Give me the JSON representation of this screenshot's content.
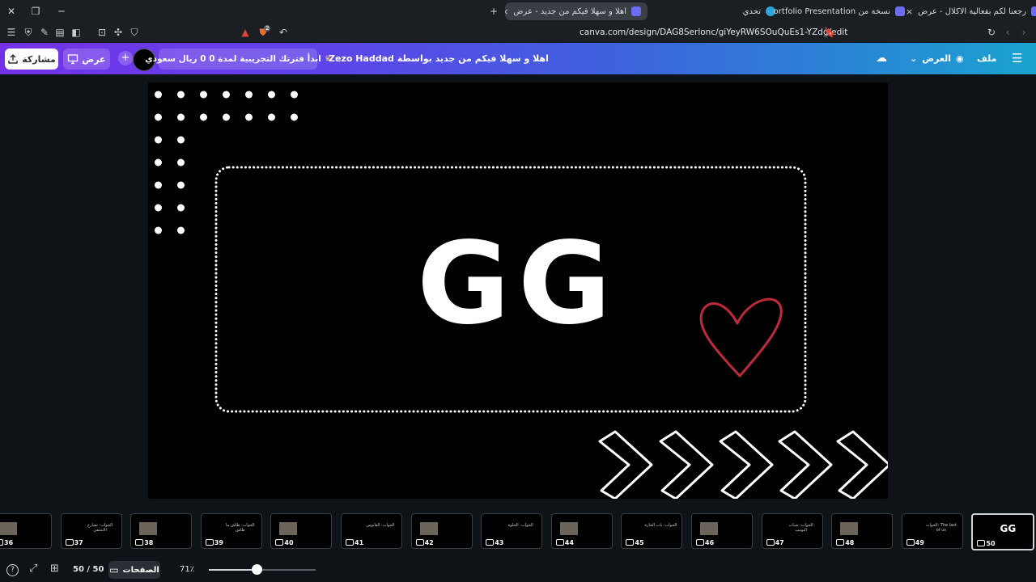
{
  "browser": {
    "tabs": [
      {
        "title": "رجعنا لكم بفعالية الاكلال - عرض",
        "favicon_color": "#6b6cf0",
        "active": false
      },
      {
        "title": "نسخة من Geometric Portfolio Presentation",
        "favicon_color": "#6b6cf0",
        "active": false
      },
      {
        "title": "تحدي",
        "favicon_color": "#2aa7d8",
        "active": false
      },
      {
        "title": "اهلا و سهلا فيكم من جديد - عرض",
        "favicon_color": "#6b6cf0",
        "active": true
      }
    ],
    "new_tab_label": "+",
    "close_label": "×",
    "url": "canva.com/design/DAG8Serlonc/giYeyRW6SOuQuEs1-YZdg/edit",
    "shields_badge": "2"
  },
  "header": {
    "menu_file": "ملف",
    "view_label": "العرض",
    "design_title": "اهلا و سهلا فيكم من جديد بواسطة Zezo Haddad",
    "trial_label": "ابدأ فترتك التجريبية لمدة 0 0 ريال سعودي",
    "add_label": "+",
    "present_label": "عرض",
    "share_label": "مشاركة"
  },
  "slide": {
    "main_text": "GG",
    "accent_heart_color": "#c0283c",
    "background_color": "#000000"
  },
  "thumbnails": [
    {
      "number": "36",
      "label": "",
      "has_photo": true
    },
    {
      "number": "37",
      "label": "الجواب: تشارع الاشتقي",
      "has_photo": false
    },
    {
      "number": "38",
      "label": "",
      "has_photo": true
    },
    {
      "number": "39",
      "label": "الجواب: طاش ما طاش",
      "has_photo": false
    },
    {
      "number": "40",
      "label": "",
      "has_photo": true
    },
    {
      "number": "41",
      "label": "الجواب: الفانوس",
      "has_photo": false
    },
    {
      "number": "42",
      "label": "",
      "has_photo": true
    },
    {
      "number": "43",
      "label": "الجواب: الخلوة",
      "has_photo": false
    },
    {
      "number": "44",
      "label": "",
      "has_photo": true
    },
    {
      "number": "45",
      "label": "الجواب: باب الحارة",
      "has_photo": false
    },
    {
      "number": "46",
      "label": "",
      "has_photo": true
    },
    {
      "number": "47",
      "label": "الجواب: شباب البومب",
      "has_photo": false
    },
    {
      "number": "48",
      "label": "",
      "has_photo": true
    },
    {
      "number": "49",
      "label": "الجواب: The last of us",
      "has_photo": false
    },
    {
      "number": "50",
      "label": "GG",
      "has_photo": false,
      "selected": true
    }
  ],
  "footer": {
    "pages_label": "الصفحات",
    "page_counter": "50 / 50",
    "zoom_label": "71٪",
    "zoom_level": 0.45
  }
}
